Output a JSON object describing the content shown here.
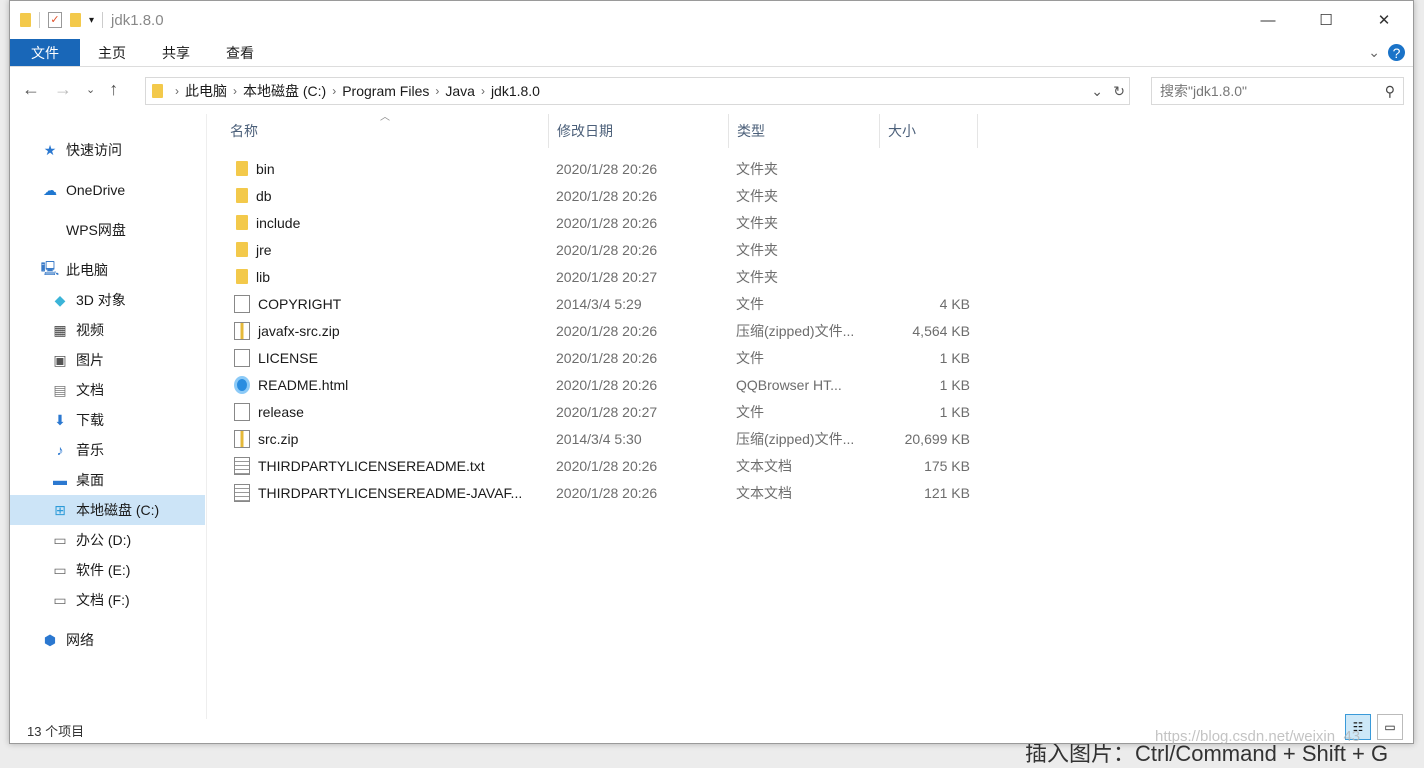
{
  "window": {
    "title": "jdk1.8.0",
    "minimize": "—",
    "maximize": "☐",
    "close": "✕"
  },
  "ribbon": {
    "tabs": [
      "文件",
      "主页",
      "共享",
      "查看"
    ],
    "expand": "⌄",
    "help": "?"
  },
  "address": {
    "crumbs": [
      "此电脑",
      "本地磁盘 (C:)",
      "Program Files",
      "Java",
      "jdk1.8.0"
    ]
  },
  "search": {
    "placeholder": "搜索\"jdk1.8.0\""
  },
  "sidebar": {
    "items": [
      {
        "label": "快速访问",
        "icon": "★",
        "color": "#2b78d0"
      },
      {
        "label": "OneDrive",
        "icon": "☁",
        "color": "#1f77d0"
      },
      {
        "label": "WPS网盘",
        "icon": "",
        "color": "#fff"
      },
      {
        "label": "此电脑",
        "icon": "🖳",
        "color": "#3a7bc8"
      },
      {
        "label": "3D 对象",
        "icon": "◆",
        "color": "#3bb4d8"
      },
      {
        "label": "视频",
        "icon": "▦",
        "color": "#444"
      },
      {
        "label": "图片",
        "icon": "▣",
        "color": "#555"
      },
      {
        "label": "文档",
        "icon": "▤",
        "color": "#777"
      },
      {
        "label": "下载",
        "icon": "⬇",
        "color": "#2b78d0"
      },
      {
        "label": "音乐",
        "icon": "♪",
        "color": "#2b78d0"
      },
      {
        "label": "桌面",
        "icon": "▬",
        "color": "#2b78d0"
      },
      {
        "label": "本地磁盘 (C:)",
        "icon": "⊞",
        "color": "#2b9ad8"
      },
      {
        "label": "办公 (D:)",
        "icon": "▭",
        "color": "#666"
      },
      {
        "label": "软件 (E:)",
        "icon": "▭",
        "color": "#666"
      },
      {
        "label": "文档 (F:)",
        "icon": "▭",
        "color": "#666"
      },
      {
        "label": "网络",
        "icon": "⬢",
        "color": "#2b78d0"
      }
    ],
    "selected": "本地磁盘 (C:)"
  },
  "columns": [
    "名称",
    "修改日期",
    "类型",
    "大小"
  ],
  "files": [
    {
      "name": "bin",
      "date": "2020/1/28 20:26",
      "type": "文件夹",
      "size": "",
      "icon": "folder"
    },
    {
      "name": "db",
      "date": "2020/1/28 20:26",
      "type": "文件夹",
      "size": "",
      "icon": "folder"
    },
    {
      "name": "include",
      "date": "2020/1/28 20:26",
      "type": "文件夹",
      "size": "",
      "icon": "folder"
    },
    {
      "name": "jre",
      "date": "2020/1/28 20:26",
      "type": "文件夹",
      "size": "",
      "icon": "folder"
    },
    {
      "name": "lib",
      "date": "2020/1/28 20:27",
      "type": "文件夹",
      "size": "",
      "icon": "folder"
    },
    {
      "name": "COPYRIGHT",
      "date": "2014/3/4 5:29",
      "type": "文件",
      "size": "4 KB",
      "icon": "doc"
    },
    {
      "name": "javafx-src.zip",
      "date": "2020/1/28 20:26",
      "type": "压缩(zipped)文件...",
      "size": "4,564 KB",
      "icon": "zip"
    },
    {
      "name": "LICENSE",
      "date": "2020/1/28 20:26",
      "type": "文件",
      "size": "1 KB",
      "icon": "doc"
    },
    {
      "name": "README.html",
      "date": "2020/1/28 20:26",
      "type": "QQBrowser HT...",
      "size": "1 KB",
      "icon": "web"
    },
    {
      "name": "release",
      "date": "2020/1/28 20:27",
      "type": "文件",
      "size": "1 KB",
      "icon": "doc"
    },
    {
      "name": "src.zip",
      "date": "2014/3/4 5:30",
      "type": "压缩(zipped)文件...",
      "size": "20,699 KB",
      "icon": "zip"
    },
    {
      "name": "THIRDPARTYLICENSEREADME.txt",
      "date": "2020/1/28 20:26",
      "type": "文本文档",
      "size": "175 KB",
      "icon": "txt"
    },
    {
      "name": "THIRDPARTYLICENSEREADME-JAVAF...",
      "date": "2020/1/28 20:26",
      "type": "文本文档",
      "size": "121 KB",
      "icon": "txt"
    }
  ],
  "status": {
    "count": "13 个项目"
  },
  "background": {
    "text": "插入图片：Ctrl/Command + Shift + G",
    "watermark": "https://blog.csdn.net/weixin_43"
  }
}
